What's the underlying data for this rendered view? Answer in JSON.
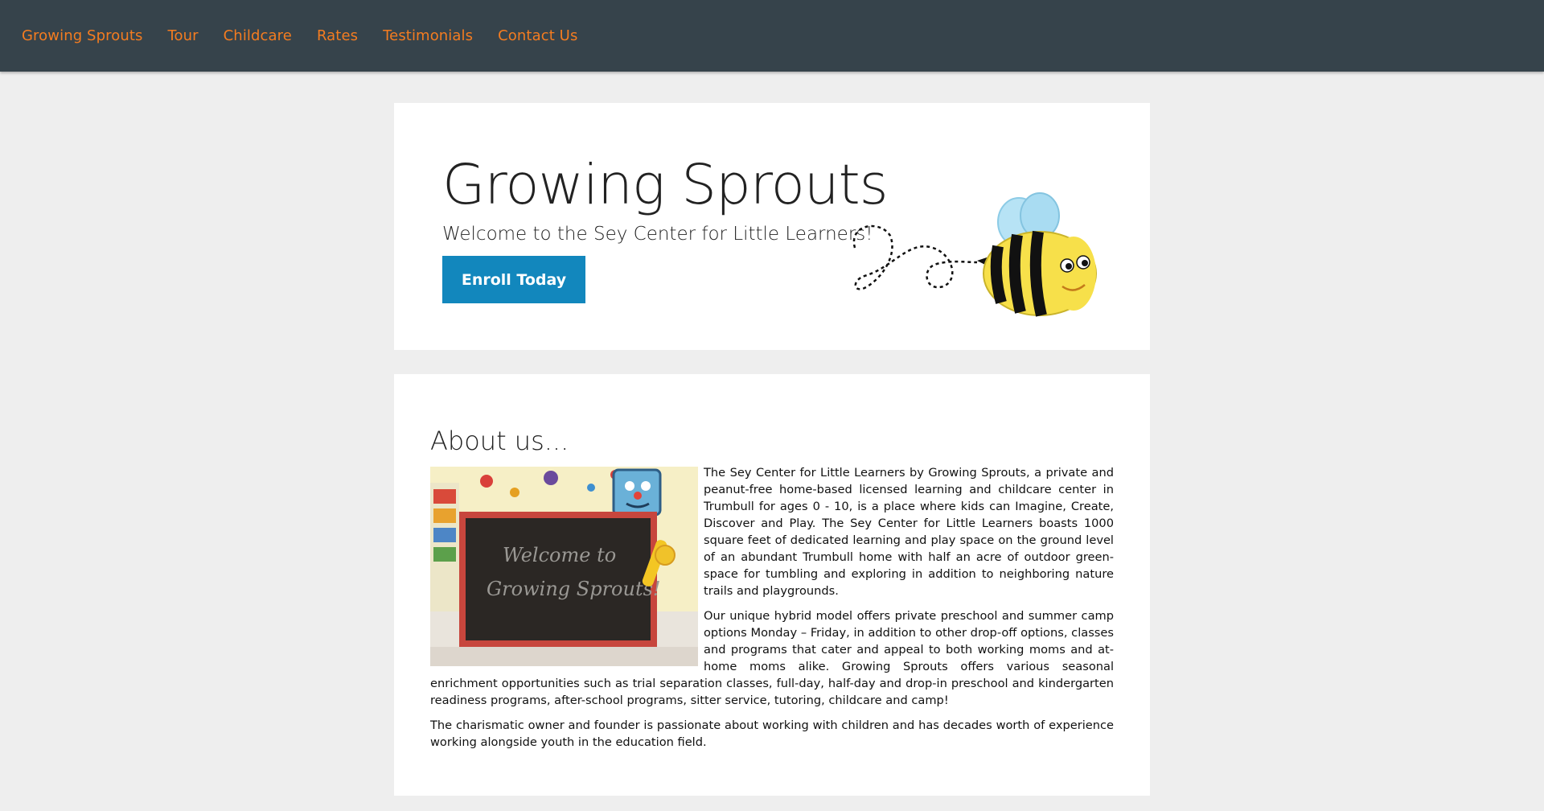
{
  "nav": {
    "brand": "Growing Sprouts",
    "items": [
      "Tour",
      "Childcare",
      "Rates",
      "Testimonials",
      "Contact Us"
    ]
  },
  "hero": {
    "title": "Growing Sprouts",
    "subtitle": "Welcome to the Sey Center for Little Learners!",
    "button_label": "Enroll Today"
  },
  "about": {
    "title": "About us...",
    "image_text": "Welcome to Growing Sprouts!",
    "paragraphs": [
      "The Sey Center for Little Learners by Growing Sprouts, a private and peanut-free home-based licensed learning and childcare center in Trumbull for ages 0 - 10, is a place where kids can Imagine, Create, Discover and Play. The Sey Center for Little Learners boasts 1000 square feet of dedicated learning and play space on the ground level of an abundant Trumbull home with half an acre of outdoor green-space for tumbling and exploring in addition to neighboring nature trails and playgrounds.",
      "Our unique hybrid model offers private preschool and summer camp options Monday – Friday, in addition to other drop-off options, classes and programs that cater and appeal to both working moms and at-home moms alike. Growing Sprouts offers various seasonal enrichment opportunities such as trial separation classes, full-day, half-day and drop-in preschool and kindergarten readiness programs, after-school programs, sitter service, tutoring, childcare and camp!",
      "The charismatic owner and founder is passionate about working with children and has decades worth of experience working alongside youth in the education field."
    ]
  },
  "colors": {
    "nav_bg": "#36434b",
    "nav_link": "#f47c20",
    "button_bg": "#1287bd",
    "page_bg": "#eeeeee"
  }
}
